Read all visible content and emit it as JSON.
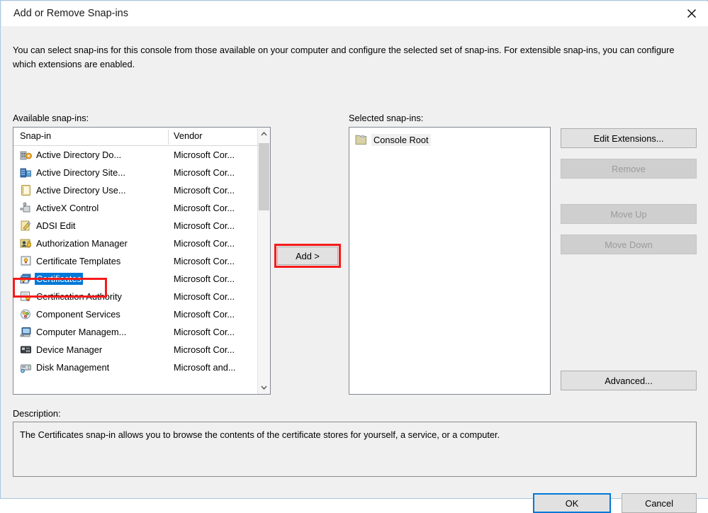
{
  "window": {
    "title": "Add or Remove Snap-ins",
    "close_icon": "close-icon"
  },
  "intro": "You can select snap-ins for this console from those available on your computer and configure the selected set of snap-ins. For extensible snap-ins, you can configure which extensions are enabled.",
  "available": {
    "label": "Available snap-ins:",
    "columns": [
      "Snap-in",
      "Vendor"
    ],
    "rows": [
      {
        "name": "Active Directory Do...",
        "vendor": "Microsoft Cor...",
        "icon": "active-directory-domains-icon",
        "selected": false
      },
      {
        "name": "Active Directory Site...",
        "vendor": "Microsoft Cor...",
        "icon": "active-directory-sites-icon",
        "selected": false
      },
      {
        "name": "Active Directory Use...",
        "vendor": "Microsoft Cor...",
        "icon": "active-directory-users-icon",
        "selected": false
      },
      {
        "name": "ActiveX Control",
        "vendor": "Microsoft Cor...",
        "icon": "activex-control-icon",
        "selected": false
      },
      {
        "name": "ADSI Edit",
        "vendor": "Microsoft Cor...",
        "icon": "adsi-edit-icon",
        "selected": false
      },
      {
        "name": "Authorization Manager",
        "vendor": "Microsoft Cor...",
        "icon": "authorization-manager-icon",
        "selected": false
      },
      {
        "name": "Certificate Templates",
        "vendor": "Microsoft Cor...",
        "icon": "certificate-templates-icon",
        "selected": false
      },
      {
        "name": "Certificates",
        "vendor": "Microsoft Cor...",
        "icon": "certificates-icon",
        "selected": true
      },
      {
        "name": "Certification Authority",
        "vendor": "Microsoft Cor...",
        "icon": "certification-authority-icon",
        "selected": false
      },
      {
        "name": "Component Services",
        "vendor": "Microsoft Cor...",
        "icon": "component-services-icon",
        "selected": false
      },
      {
        "name": "Computer Managem...",
        "vendor": "Microsoft Cor...",
        "icon": "computer-management-icon",
        "selected": false
      },
      {
        "name": "Device Manager",
        "vendor": "Microsoft Cor...",
        "icon": "device-manager-icon",
        "selected": false
      },
      {
        "name": "Disk Management",
        "vendor": "Microsoft and...",
        "icon": "disk-management-icon",
        "selected": false
      }
    ]
  },
  "add_button": "Add >",
  "selected_panel": {
    "label": "Selected snap-ins:",
    "items": [
      {
        "label": "Console Root",
        "icon": "folder-icon"
      }
    ]
  },
  "side_buttons": {
    "edit_extensions": "Edit Extensions...",
    "remove": "Remove",
    "move_up": "Move Up",
    "move_down": "Move Down",
    "advanced": "Advanced..."
  },
  "description": {
    "label": "Description:",
    "text": "The Certificates snap-in allows you to browse the contents of the certificate stores for yourself, a service, or a computer."
  },
  "footer": {
    "ok": "OK",
    "cancel": "Cancel"
  },
  "colors": {
    "selection_blue": "#0078d7",
    "annotation_red": "#f51b1b",
    "dialog_bg": "#f0f0f0"
  }
}
